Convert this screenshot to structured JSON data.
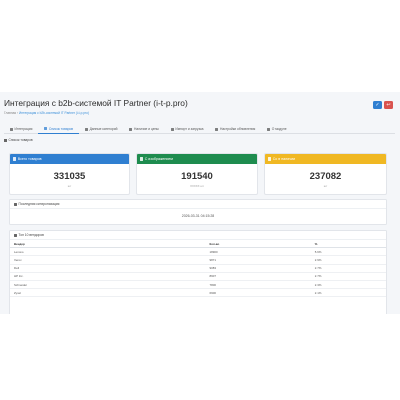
{
  "page": {
    "title": "Интеграция с b2b-системой IT Partner (i-t-p.pro)",
    "breadcrumb": [
      "Главная",
      "Интеграция с b2b-системой IT Partner (i-t-p.pro)"
    ],
    "buttons": {
      "save_icon": "save-icon",
      "close_icon": "close-icon"
    }
  },
  "tabs": [
    {
      "label": "Интеграция",
      "active": false
    },
    {
      "label": "Список товаров",
      "active": true
    },
    {
      "label": "Данные категорий",
      "active": false
    },
    {
      "label": "Наличие и цены",
      "active": false
    },
    {
      "label": "Импорт и загрузка",
      "active": false
    },
    {
      "label": "Настройки обновления",
      "active": false
    },
    {
      "label": "О модуле",
      "active": false
    }
  ],
  "section_title": "Список товаров",
  "stats": [
    {
      "label": "Всего товаров",
      "value": "331035",
      "sub": "шт",
      "color": "#2f7fd1"
    },
    {
      "label": "С изображением",
      "value": "191540",
      "sub": "XXXXX шт",
      "color": "#1e8c4f"
    },
    {
      "label": "Со в наличии",
      "value": "237082",
      "sub": "шт",
      "color": "#f0b823"
    }
  ],
  "last_sync": {
    "label": "Последняя синхронизация",
    "value": "2026-03-31 04:15:28"
  },
  "top_table": {
    "title": "Топ 10 вендоров",
    "headers": [
      "Вендор",
      "Кол-во",
      "%"
    ],
    "rows": [
      [
        "Lenovo",
        "18900",
        "5.6%"
      ],
      [
        "Xerox",
        "9871",
        "2.9%"
      ],
      [
        "Dell",
        "9083",
        "2.7%"
      ],
      [
        "HP Inc.",
        "8907",
        "2.7%"
      ],
      [
        "Schneider",
        "7800",
        "2.3%"
      ],
      [
        "Zyxel",
        "6900",
        "2.1%"
      ]
    ]
  },
  "colors": {
    "accent": "#2f7fd1",
    "green": "#1e8c4f",
    "yellow": "#f0b823",
    "red": "#d9534f"
  }
}
